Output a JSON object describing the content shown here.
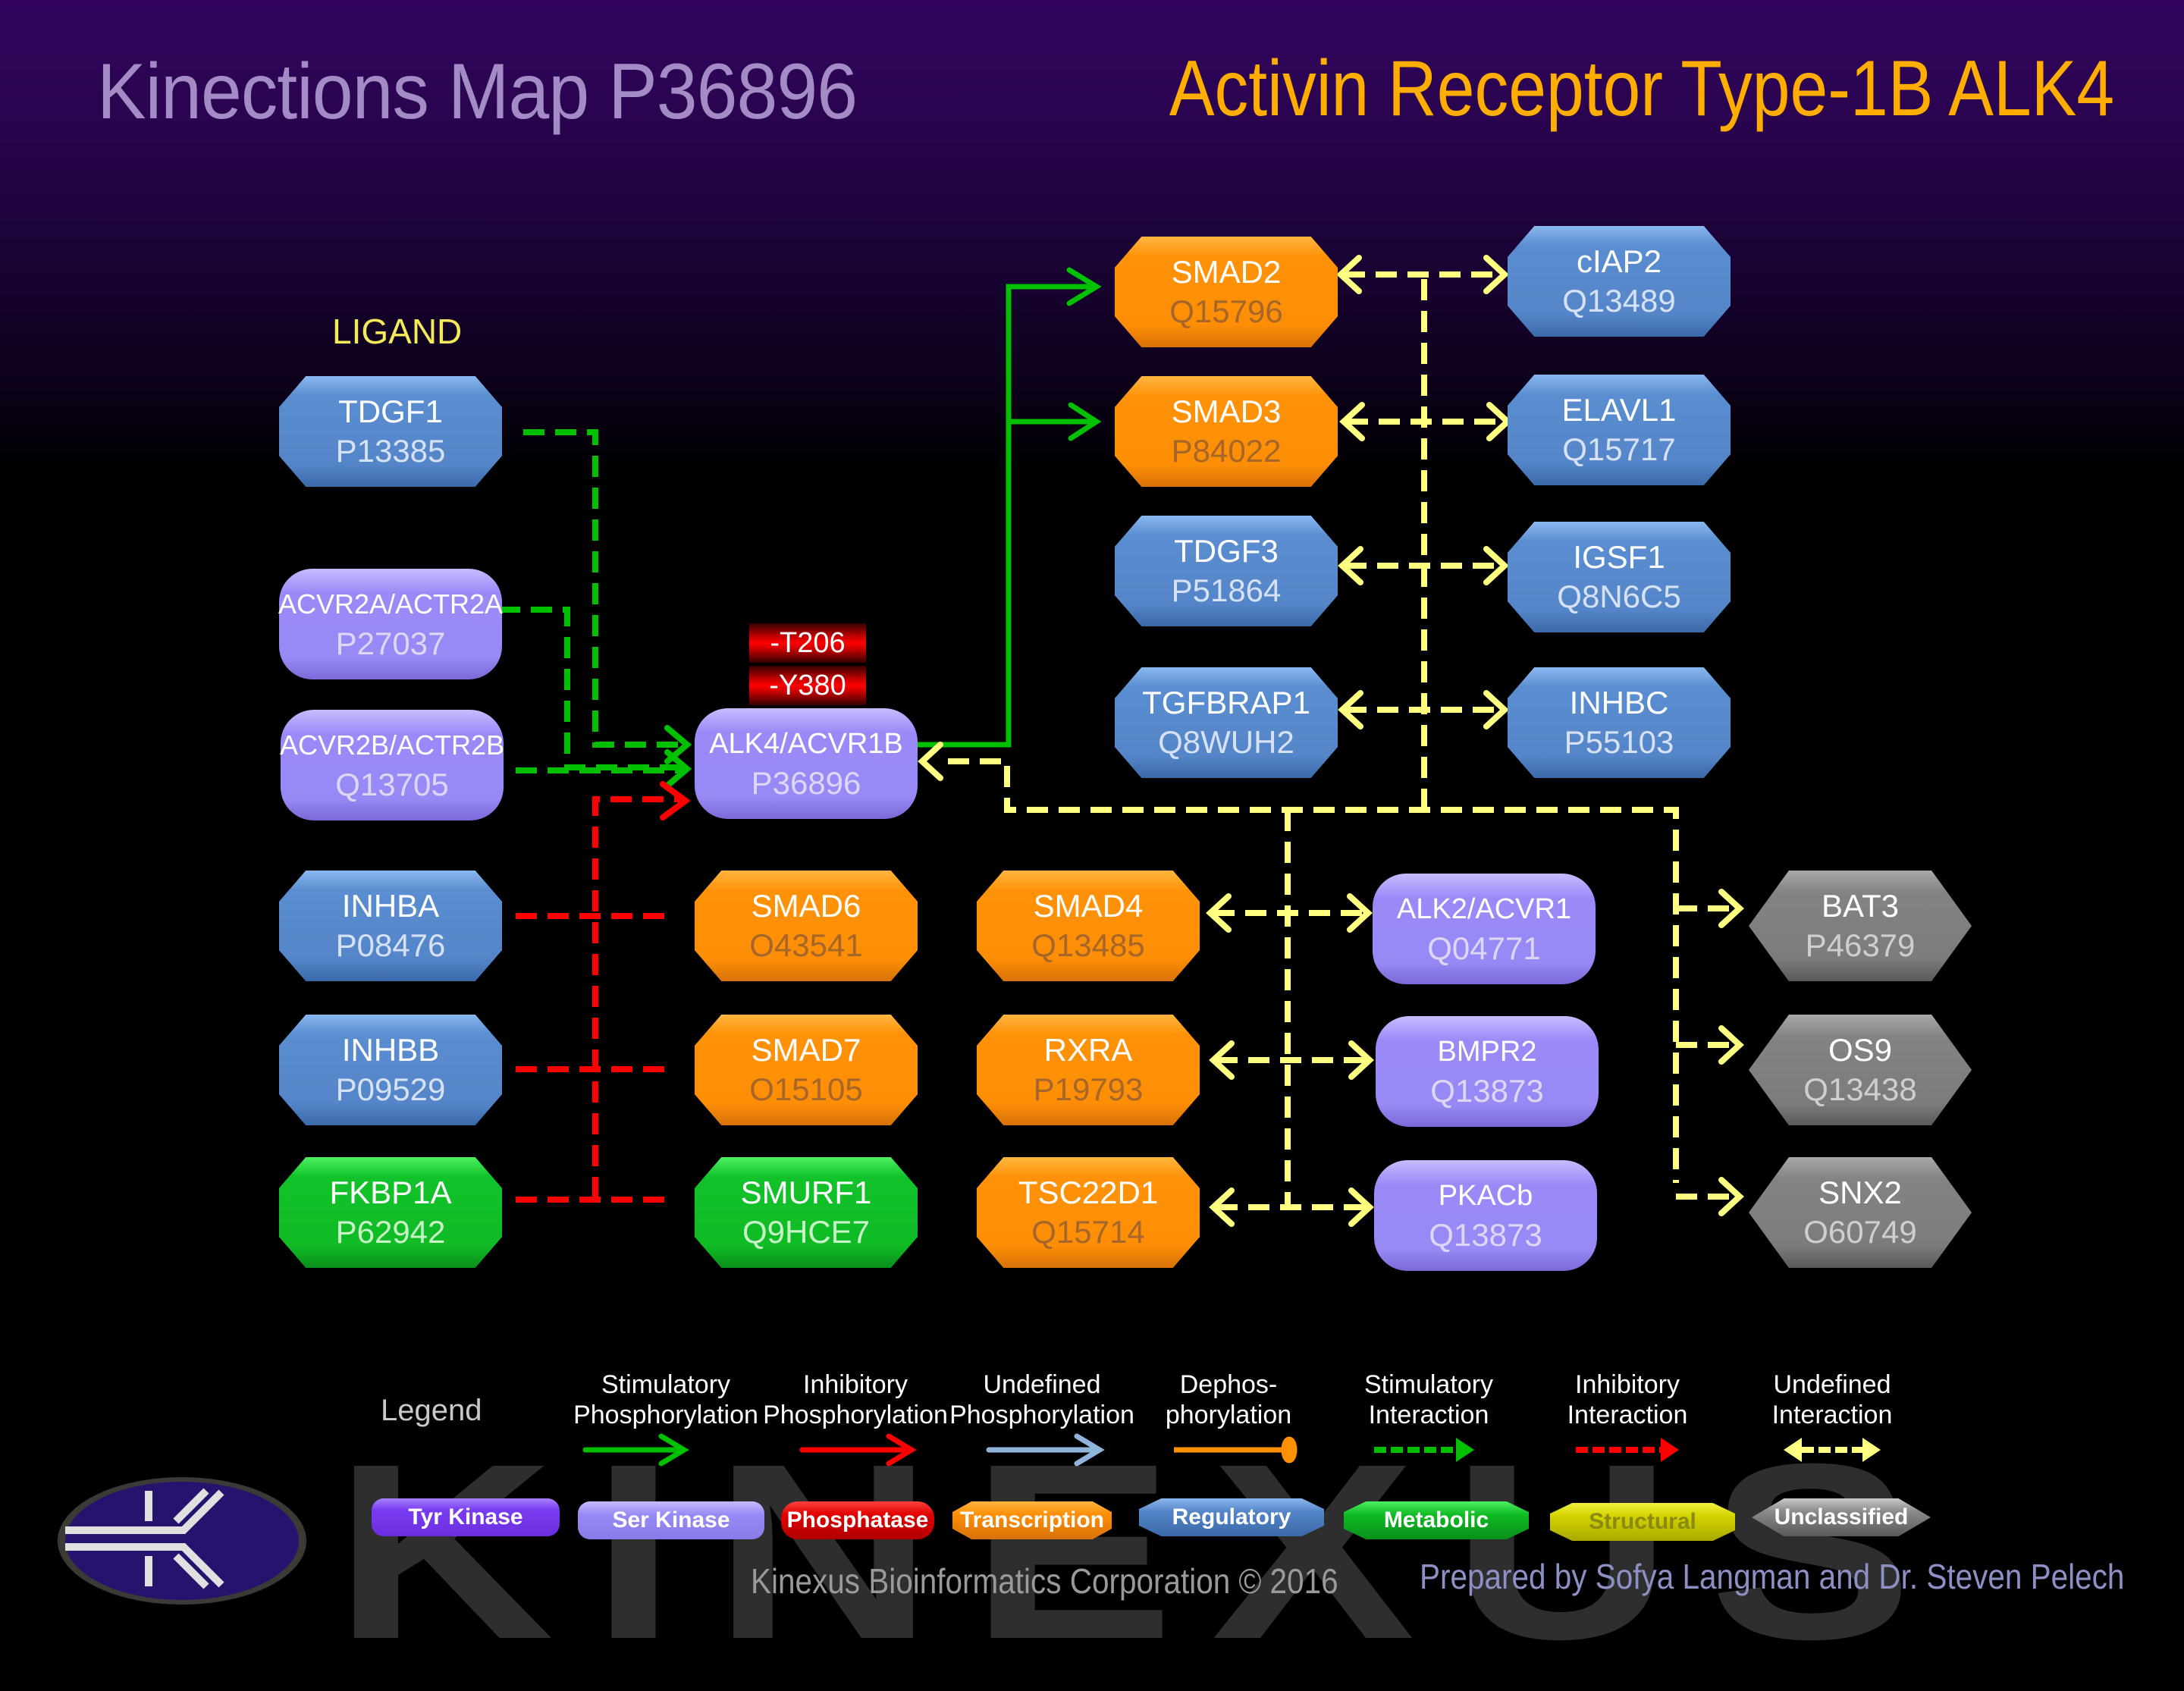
{
  "header": {
    "map_title": "Kinections Map P36896",
    "protein_title": "Activin Receptor Type-1B  ALK4"
  },
  "section_labels": {
    "ligand": "LIGAND"
  },
  "colors": {
    "tyr_kinase": "#7a3cf0",
    "ser_kinase": "#978af5",
    "phosphatase": "#e00000",
    "transcription": "#fd8e05",
    "regulatory": "#5485c8",
    "metabolic": "#10bb24",
    "structural": "#d4d400",
    "unclassified": "#7c7c7c",
    "stimulatory": "#00c000",
    "inhibitory": "#ff0000",
    "undefined_interaction": "#ffff80",
    "undefined_phosphorylation": "#8fb4dc",
    "dephosphorylation": "#ff9000"
  },
  "nodes": {
    "tdgf1": {
      "name": "TDGF1",
      "id": "P13385",
      "category": "Regulatory"
    },
    "acvr2a": {
      "name": "ACVR2A/ACTR2A",
      "id": "P27037",
      "category": "Ser Kinase"
    },
    "acvr2b": {
      "name": "ACVR2B/ACTR2B",
      "id": "Q13705",
      "category": "Ser Kinase"
    },
    "alk4": {
      "name": "ALK4/ACVR1B",
      "id": "P36896",
      "category": "Ser Kinase"
    },
    "inhba": {
      "name": "INHBA",
      "id": "P08476",
      "category": "Regulatory"
    },
    "inhbb": {
      "name": "INHBB",
      "id": "P09529",
      "category": "Regulatory"
    },
    "fkbp1a": {
      "name": "FKBP1A",
      "id": "P62942",
      "category": "Metabolic"
    },
    "smad6": {
      "name": "SMAD6",
      "id": "O43541",
      "category": "Transcription"
    },
    "smad7": {
      "name": "SMAD7",
      "id": "O15105",
      "category": "Transcription"
    },
    "smurf1": {
      "name": "SMURF1",
      "id": "Q9HCE7",
      "category": "Metabolic"
    },
    "smad2": {
      "name": "SMAD2",
      "id": "Q15796",
      "category": "Transcription"
    },
    "smad3": {
      "name": "SMAD3",
      "id": "P84022",
      "category": "Transcription"
    },
    "tdgf3": {
      "name": "TDGF3",
      "id": "P51864",
      "category": "Regulatory"
    },
    "tgfbrap1": {
      "name": "TGFBRAP1",
      "id": "Q8WUH2",
      "category": "Regulatory"
    },
    "ciap2": {
      "name": "cIAP2",
      "id": "Q13489",
      "category": "Regulatory"
    },
    "elavl1": {
      "name": "ELAVL1",
      "id": "Q15717",
      "category": "Regulatory"
    },
    "igsf1": {
      "name": "IGSF1",
      "id": "Q8N6C5",
      "category": "Regulatory"
    },
    "inhbc": {
      "name": "INHBC",
      "id": "P55103",
      "category": "Regulatory"
    },
    "smad4": {
      "name": "SMAD4",
      "id": "Q13485",
      "category": "Transcription"
    },
    "rxra": {
      "name": "RXRA",
      "id": "P19793",
      "category": "Transcription"
    },
    "tsc22d1": {
      "name": "TSC22D1",
      "id": "Q15714",
      "category": "Transcription"
    },
    "alk2": {
      "name": "ALK2/ACVR1",
      "id": "Q04771",
      "category": "Ser Kinase"
    },
    "bmpr2": {
      "name": "BMPR2",
      "id": "Q13873",
      "category": "Ser Kinase"
    },
    "pkacb": {
      "name": "PKACb",
      "id": "Q13873",
      "category": "Ser Kinase"
    },
    "bat3": {
      "name": "BAT3",
      "id": "P46379",
      "category": "Unclassified"
    },
    "os9": {
      "name": "OS9",
      "id": "Q13438",
      "category": "Unclassified"
    },
    "snx2": {
      "name": "SNX2",
      "id": "O60749",
      "category": "Unclassified"
    }
  },
  "phosphosites": [
    "-T206",
    "-Y380"
  ],
  "interactions": [
    {
      "from": "TDGF1",
      "to": "ALK4/ACVR1B",
      "type": "Stimulatory Interaction"
    },
    {
      "from": "ACVR2A/ACTR2A",
      "to": "ALK4/ACVR1B",
      "type": "Stimulatory Interaction"
    },
    {
      "from": "ACVR2B/ACTR2B",
      "to": "ALK4/ACVR1B",
      "type": "Stimulatory Interaction"
    },
    {
      "from": "INHBA",
      "to": "ALK4/ACVR1B",
      "type": "Inhibitory Interaction"
    },
    {
      "from": "INHBB",
      "to": "ALK4/ACVR1B",
      "type": "Inhibitory Interaction"
    },
    {
      "from": "FKBP1A",
      "to": "ALK4/ACVR1B",
      "type": "Inhibitory Interaction"
    },
    {
      "from": "SMAD6",
      "to": "ALK4/ACVR1B",
      "type": "Inhibitory Interaction"
    },
    {
      "from": "SMAD7",
      "to": "ALK4/ACVR1B",
      "type": "Inhibitory Interaction"
    },
    {
      "from": "SMURF1",
      "to": "ALK4/ACVR1B",
      "type": "Inhibitory Interaction"
    },
    {
      "from": "ALK4/ACVR1B",
      "to": "SMAD2",
      "type": "Stimulatory Phosphorylation"
    },
    {
      "from": "ALK4/ACVR1B",
      "to": "SMAD3",
      "type": "Stimulatory Phosphorylation"
    },
    {
      "from": "ALK4/ACVR1B",
      "to": "SMAD2, SMAD3, TDGF3, TGFBRAP1, cIAP2, ELAVL1, IGSF1, INHBC, SMAD4, RXRA, TSC22D1, ALK2/ACVR1, BMPR2, PKACb, BAT3, OS9, SNX2",
      "type": "Undefined Interaction"
    }
  ],
  "legend": {
    "title": "Legend",
    "arrows": [
      {
        "label_line1": "Stimulatory",
        "label_line2": "Phosphorylation"
      },
      {
        "label_line1": "Inhibitory",
        "label_line2": "Phosphorylation"
      },
      {
        "label_line1": "Undefined",
        "label_line2": "Phosphorylation"
      },
      {
        "label_line1": "Dephos-",
        "label_line2": "phorylation"
      },
      {
        "label_line1": "Stimulatory",
        "label_line2": "Interaction"
      },
      {
        "label_line1": "Inhibitory",
        "label_line2": "Interaction"
      },
      {
        "label_line1": "Undefined",
        "label_line2": "Interaction"
      }
    ],
    "categories": [
      "Tyr Kinase",
      "Ser Kinase",
      "Phosphatase",
      "Transcription",
      "Regulatory",
      "Metabolic",
      "Structural",
      "Unclassified"
    ]
  },
  "footer": {
    "watermark": "KINEXUS",
    "copyright": "Kinexus Bioinformatics Corporation © 2016",
    "credits": "Prepared by Sofya Langman and Dr. Steven Pelech"
  }
}
